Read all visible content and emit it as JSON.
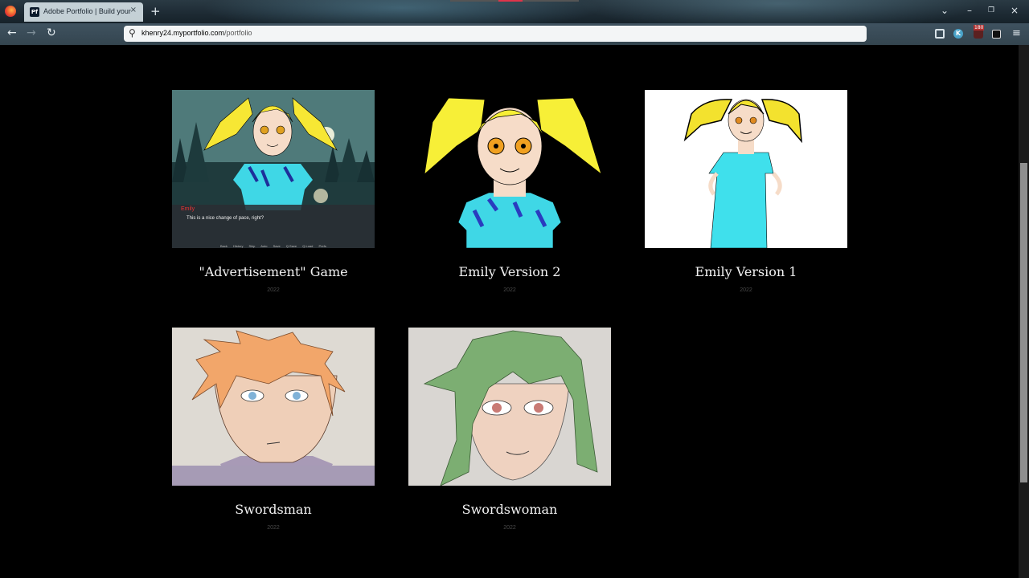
{
  "browser": {
    "tab_title": "Adobe Portfolio | Build your",
    "tab_favicon": "Pf",
    "url_domain": "khenry24.myportfolio.com",
    "url_path": "/portfolio",
    "shield_badge": "180",
    "ext_k": "K"
  },
  "icons": {
    "back": "←",
    "forward": "→",
    "reload": "↻",
    "search": "⚲",
    "menu": "≡",
    "new_tab": "+",
    "close": "×",
    "chevron": "⌄",
    "minimize": "–",
    "restore": "❐",
    "win_close": "×"
  },
  "projects": [
    {
      "title": "\"Advertisement\" Game",
      "year": "2022",
      "dialog_name": "Emily",
      "dialog_text": "This is a nice change of pace, right?",
      "dialog_menu": "Back History Skip Auto Save Q.Save Q.Load Prefs"
    },
    {
      "title": "Emily Version 2",
      "year": "2022"
    },
    {
      "title": "Emily Version 1",
      "year": "2022"
    },
    {
      "title": "Swordsman",
      "year": "2022"
    },
    {
      "title": "Swordswoman",
      "year": "2022"
    }
  ]
}
